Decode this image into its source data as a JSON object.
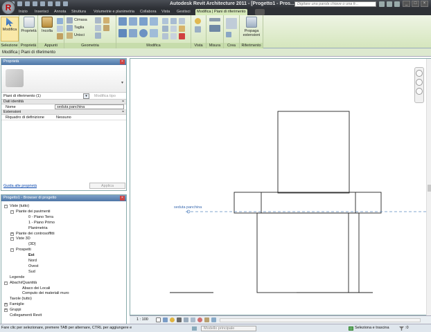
{
  "window": {
    "title": "Autodesk Revit Architecture 2011 - [Progetto1 - Pros...",
    "search_placeholder": "Digitare una parola chiave o una fr...",
    "buttons": [
      "_",
      "□",
      "×"
    ]
  },
  "app_button": "R",
  "tabs": [
    {
      "label": "Inizio",
      "active": false
    },
    {
      "label": "Inserisci",
      "active": false
    },
    {
      "label": "Annota",
      "active": false
    },
    {
      "label": "Struttura",
      "active": false
    },
    {
      "label": "Volumetrie e planimetria",
      "active": false
    },
    {
      "label": "Collabora",
      "active": false
    },
    {
      "label": "Vista",
      "active": false
    },
    {
      "label": "Gestisci",
      "active": false
    },
    {
      "label": "Modifica | Piani di riferimento",
      "active": true
    }
  ],
  "ribbon": {
    "groups": {
      "selezione": "Selezione",
      "proprieta": "Proprietà",
      "appunti": "Appunti",
      "geometria": "Geometria",
      "modifica": "Modifica",
      "vista": "Vista",
      "misura": "Misura",
      "crea": "Crea",
      "riferimento": "Riferimento"
    },
    "buttons": {
      "modifica": "Modifica",
      "proprieta": "Proprietà",
      "incolla": "Incolla",
      "cimasa": "Cimasa",
      "taglia": "Taglia",
      "unisci": "Unisci",
      "propaga": "Propaga",
      "estensioni": "estensioni"
    }
  },
  "options_bar": "Modifica | Piani di riferimento",
  "properties": {
    "title": "Proprietà",
    "type_selector": "Piani di riferimento (1)",
    "edit_type": "Modifica tipo",
    "category_identity": "Dati identità",
    "name_label": "Nome",
    "name_value": "seduta panchina",
    "category_extents": "Estensioni",
    "scope_label": "Riquadro di definizione",
    "scope_value": "Nessuno",
    "help_link": "Guida alle proprietà",
    "apply": "Applica"
  },
  "browser": {
    "title": "Progetto1 - Browser di progetto",
    "items": [
      {
        "label": "Viste (tutto)",
        "level": 0,
        "toggle": "-"
      },
      {
        "label": "Piante dei pavimenti",
        "level": 1,
        "toggle": "-"
      },
      {
        "label": "0 - Piano Terra",
        "level": 3,
        "toggle": ""
      },
      {
        "label": "1 - Piano Primo",
        "level": 3,
        "toggle": ""
      },
      {
        "label": "Planimetria",
        "level": 3,
        "toggle": ""
      },
      {
        "label": "Piante dei controsoffitti",
        "level": 1,
        "toggle": "+"
      },
      {
        "label": "Viste 3D",
        "level": 1,
        "toggle": "-"
      },
      {
        "label": "{3D}",
        "level": 3,
        "toggle": ""
      },
      {
        "label": "Prospetti",
        "level": 1,
        "toggle": "-"
      },
      {
        "label": "Est",
        "level": 3,
        "toggle": "",
        "bold": true
      },
      {
        "label": "Nord",
        "level": 3,
        "toggle": ""
      },
      {
        "label": "Ovest",
        "level": 3,
        "toggle": ""
      },
      {
        "label": "Sud",
        "level": 3,
        "toggle": ""
      },
      {
        "label": "Legende",
        "level": 0,
        "toggle": ""
      },
      {
        "label": "Abachi/Quantità",
        "level": 0,
        "toggle": "-"
      },
      {
        "label": "Abaco dei Locali",
        "level": 2,
        "toggle": ""
      },
      {
        "label": "Computo dei materiali muro",
        "level": 2,
        "toggle": ""
      },
      {
        "label": "Tavole (tutto)",
        "level": 0,
        "toggle": ""
      },
      {
        "label": "Famiglie",
        "level": 0,
        "toggle": "+"
      },
      {
        "label": "Gruppi",
        "level": 0,
        "toggle": "+"
      },
      {
        "label": "Collegamenti Revit",
        "level": 0,
        "toggle": ""
      }
    ]
  },
  "canvas": {
    "ref_plane_label": "seduta panchina"
  },
  "view_control": {
    "scale": "1 : 100"
  },
  "status": {
    "hint": "Fare clic per selezionare, premere TAB per alternare, CTRL per aggiungere e",
    "model": "Modello principale",
    "drag": "Seleziona e trascina",
    "filter": ":0"
  }
}
